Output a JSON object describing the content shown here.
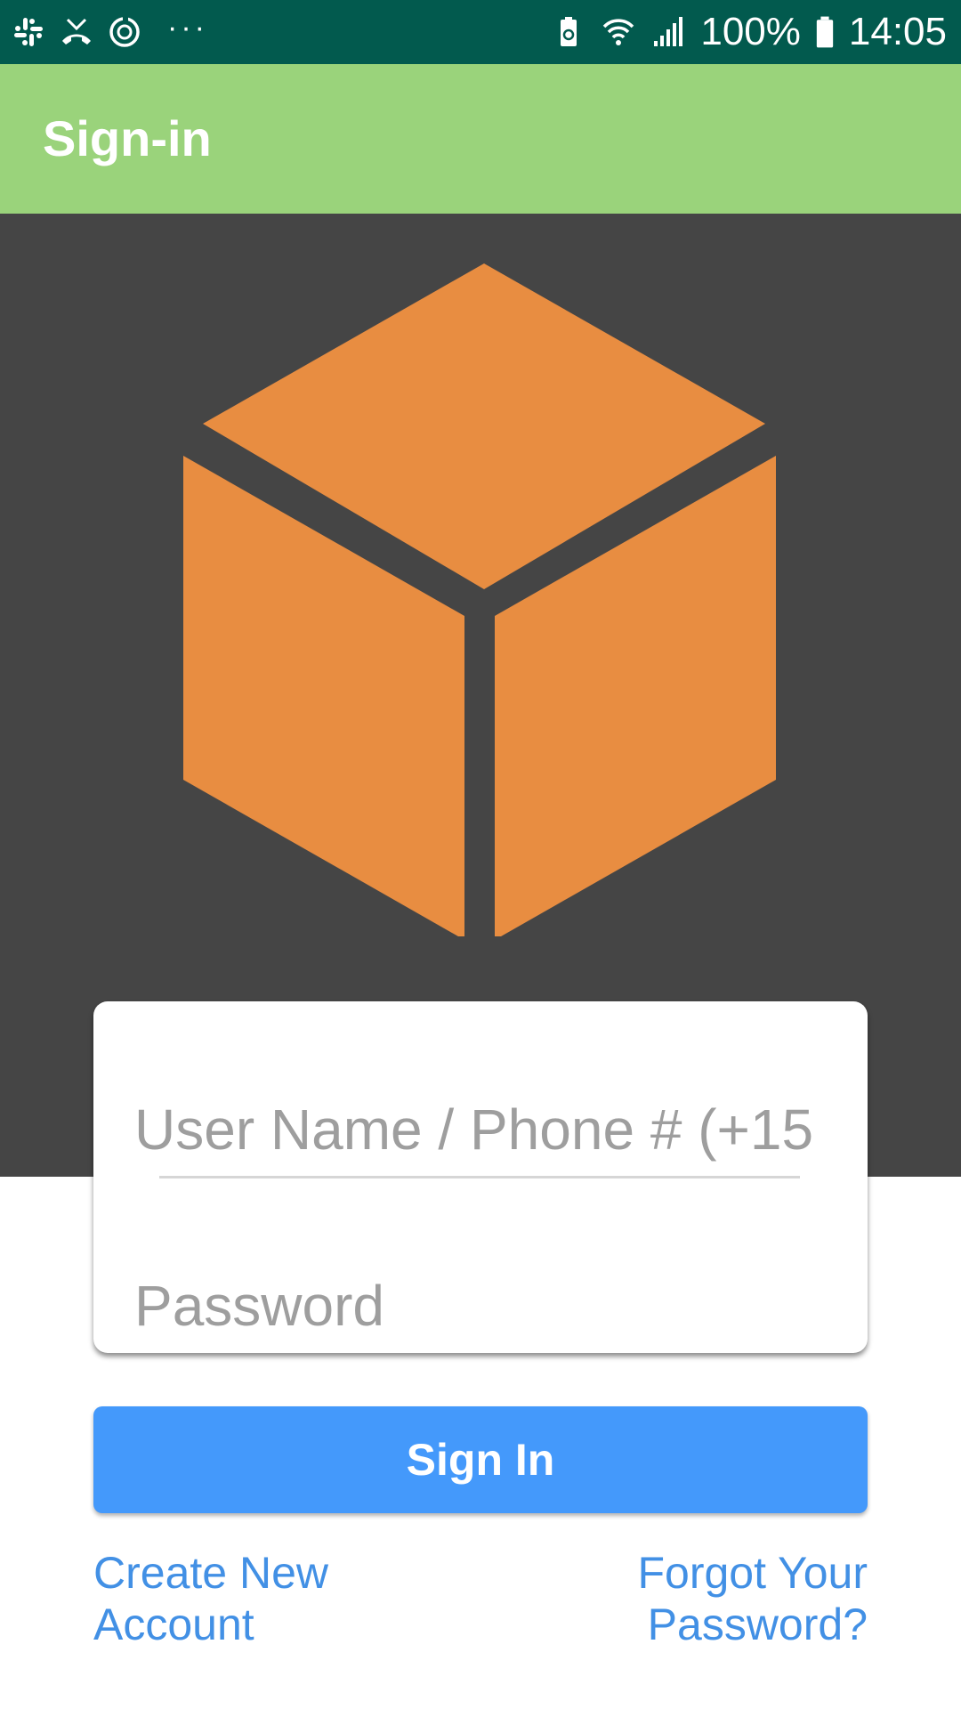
{
  "status_bar": {
    "left_icons": [
      "slack-icon",
      "missed-call-icon",
      "sync-icon"
    ],
    "more_indicator": "···",
    "right_icons": [
      "battery-saver-icon",
      "wifi-icon",
      "signal-icon",
      "battery-icon"
    ],
    "battery_text": "100%",
    "time": "14:05",
    "background_color": "#025a4e"
  },
  "app_bar": {
    "title": "Sign-in",
    "background_color": "#9ad37b"
  },
  "hero": {
    "logo_icon": "orange-cube-logo-icon",
    "logo_color": "#e88d41",
    "background_color": "#454545"
  },
  "form": {
    "username_placeholder": "User Name / Phone # (+15",
    "username_value": "",
    "password_placeholder": "Password",
    "password_value": ""
  },
  "actions": {
    "sign_in_label": "Sign In",
    "sign_in_color": "#4499fb",
    "create_account_line1": "Create New",
    "create_account_line2": "Account",
    "forgot_password_line1": "Forgot Your",
    "forgot_password_line2": "Password?",
    "link_color": "#4290e5"
  }
}
